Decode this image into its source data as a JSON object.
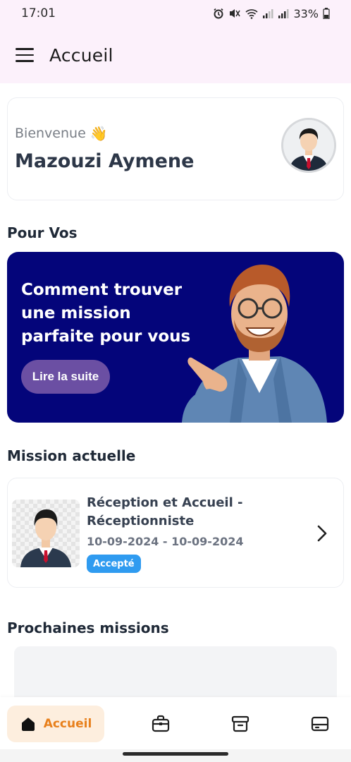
{
  "status_bar": {
    "time": "17:01",
    "battery": "33%"
  },
  "app_bar": {
    "title": "Accueil"
  },
  "welcome": {
    "greeting": "Bienvenue",
    "emoji": "👋",
    "user_name": "Mazouzi Aymene"
  },
  "sections": {
    "for_you": "Pour Vos",
    "current_mission": "Mission actuelle",
    "upcoming_missions": "Prochaines missions"
  },
  "banner": {
    "text": "Comment trouver une mission parfaite pour vous",
    "button_label": "Lire la suite",
    "background": "#04057a",
    "button_color": "#6b4fa3"
  },
  "mission": {
    "title": "Réception et Accueil - Réceptionniste",
    "start_date": "10-09-2024",
    "date_separator": " - ",
    "end_date": "10-09-2024",
    "status": "Accepté",
    "status_color": "#2f9bf0"
  },
  "bottom_nav": {
    "items": [
      {
        "label": "Accueil",
        "icon": "home-icon",
        "active": true
      },
      {
        "label": "",
        "icon": "briefcase-icon",
        "active": false
      },
      {
        "label": "",
        "icon": "archive-icon",
        "active": false
      },
      {
        "label": "",
        "icon": "card-icon",
        "active": false
      }
    ],
    "accent": "#e8801c"
  }
}
